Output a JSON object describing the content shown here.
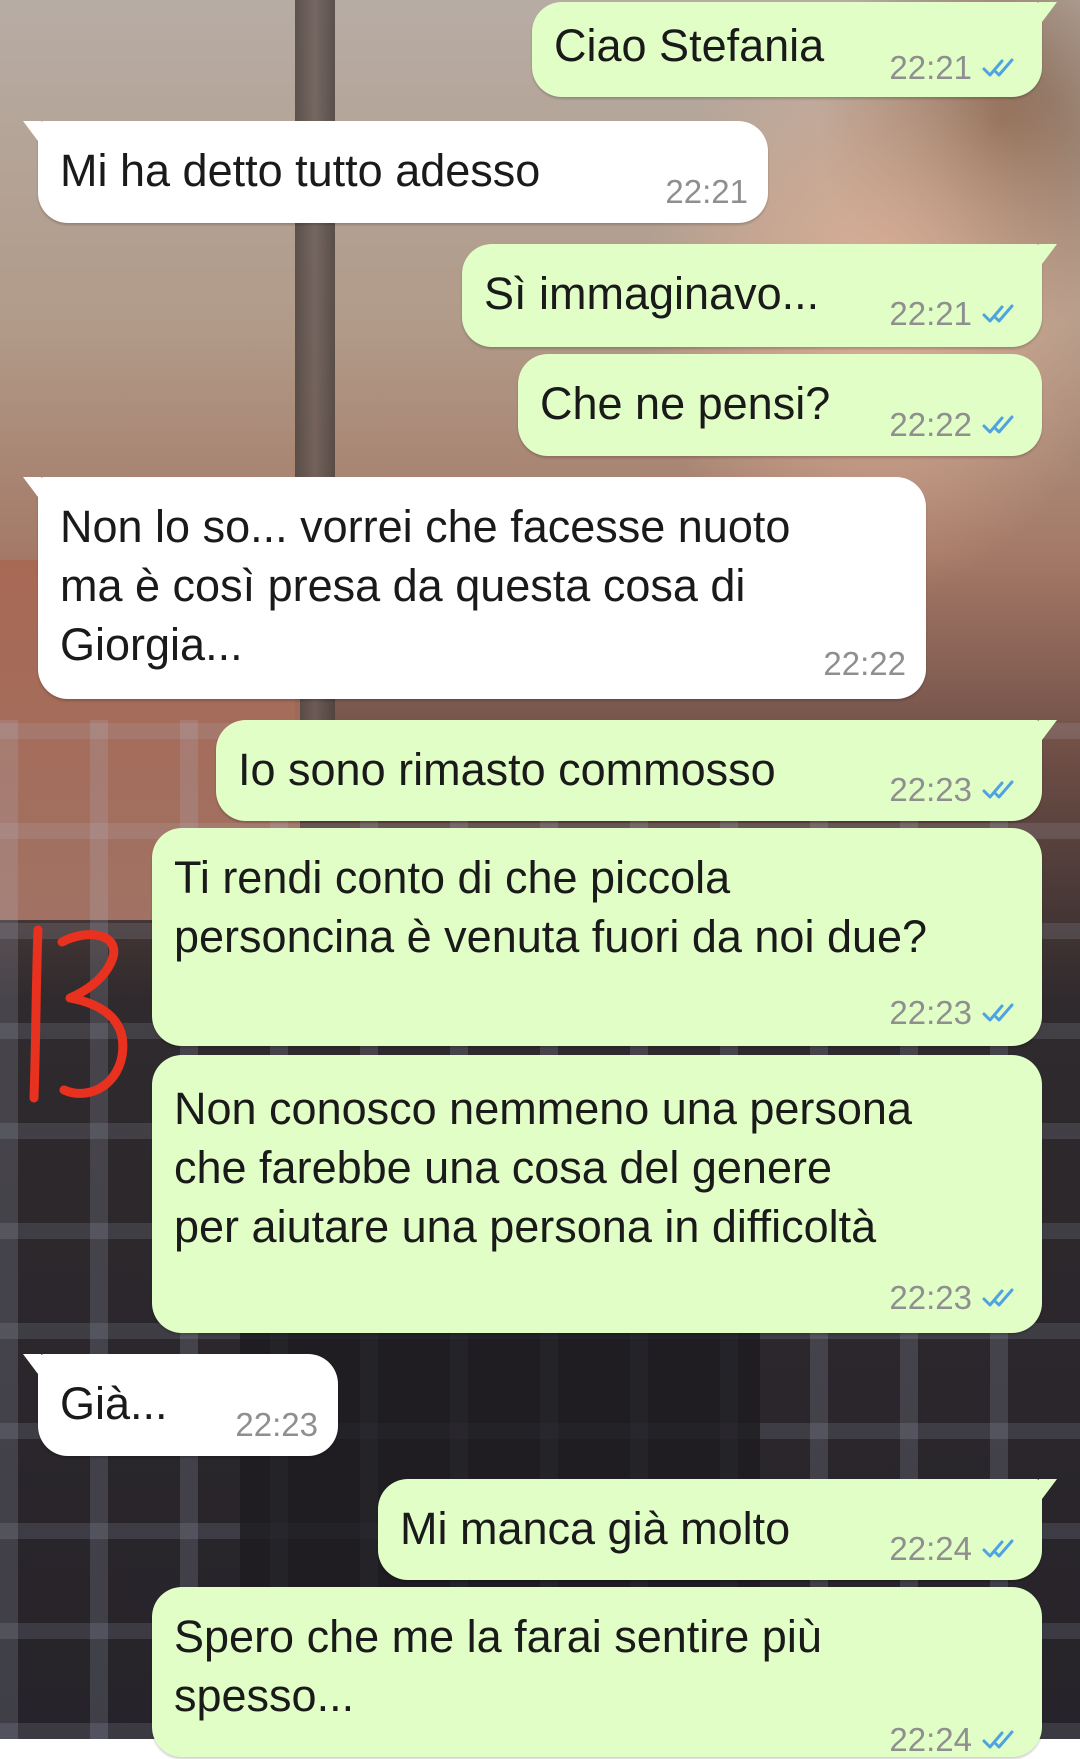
{
  "messages": [
    {
      "dir": "out",
      "text": "Ciao Stefania",
      "time": "22:21",
      "read": true
    },
    {
      "dir": "in",
      "text": "Mi ha detto tutto adesso",
      "time": "22:21"
    },
    {
      "dir": "out",
      "text": "Sì immaginavo...",
      "time": "22:21",
      "read": true
    },
    {
      "dir": "out",
      "text": "Che ne pensi?",
      "time": "22:22",
      "read": true
    },
    {
      "dir": "in",
      "lines": [
        "Non lo so... vorrei che facesse nuoto",
        "ma è così presa da questa cosa di",
        "Giorgia..."
      ],
      "time": "22:22"
    },
    {
      "dir": "out",
      "text": "Io sono rimasto commosso",
      "time": "22:23",
      "read": true
    },
    {
      "dir": "out",
      "lines": [
        "Ti rendi conto di che piccola",
        "personcina è venuta fuori da noi due?"
      ],
      "time": "22:23",
      "read": true
    },
    {
      "dir": "out",
      "lines": [
        "Non conosco nemmeno una persona",
        "che farebbe una cosa del genere",
        "per aiutare una persona in difficoltà"
      ],
      "time": "22:23",
      "read": true
    },
    {
      "dir": "in",
      "text": "Già...",
      "time": "22:23"
    },
    {
      "dir": "out",
      "text": "Mi manca già molto",
      "time": "22:24",
      "read": true
    },
    {
      "dir": "out",
      "lines": [
        "Spero che me la farai sentire più",
        "spesso..."
      ],
      "time": "22:24",
      "read": true
    }
  ],
  "annotation": {
    "text": "13",
    "color": "#e8311f"
  },
  "colors": {
    "outgoing_bubble": "#e1fec7",
    "incoming_bubble": "#ffffff",
    "read_check": "#4fa3e0",
    "time_text": "#8f8f8f"
  }
}
